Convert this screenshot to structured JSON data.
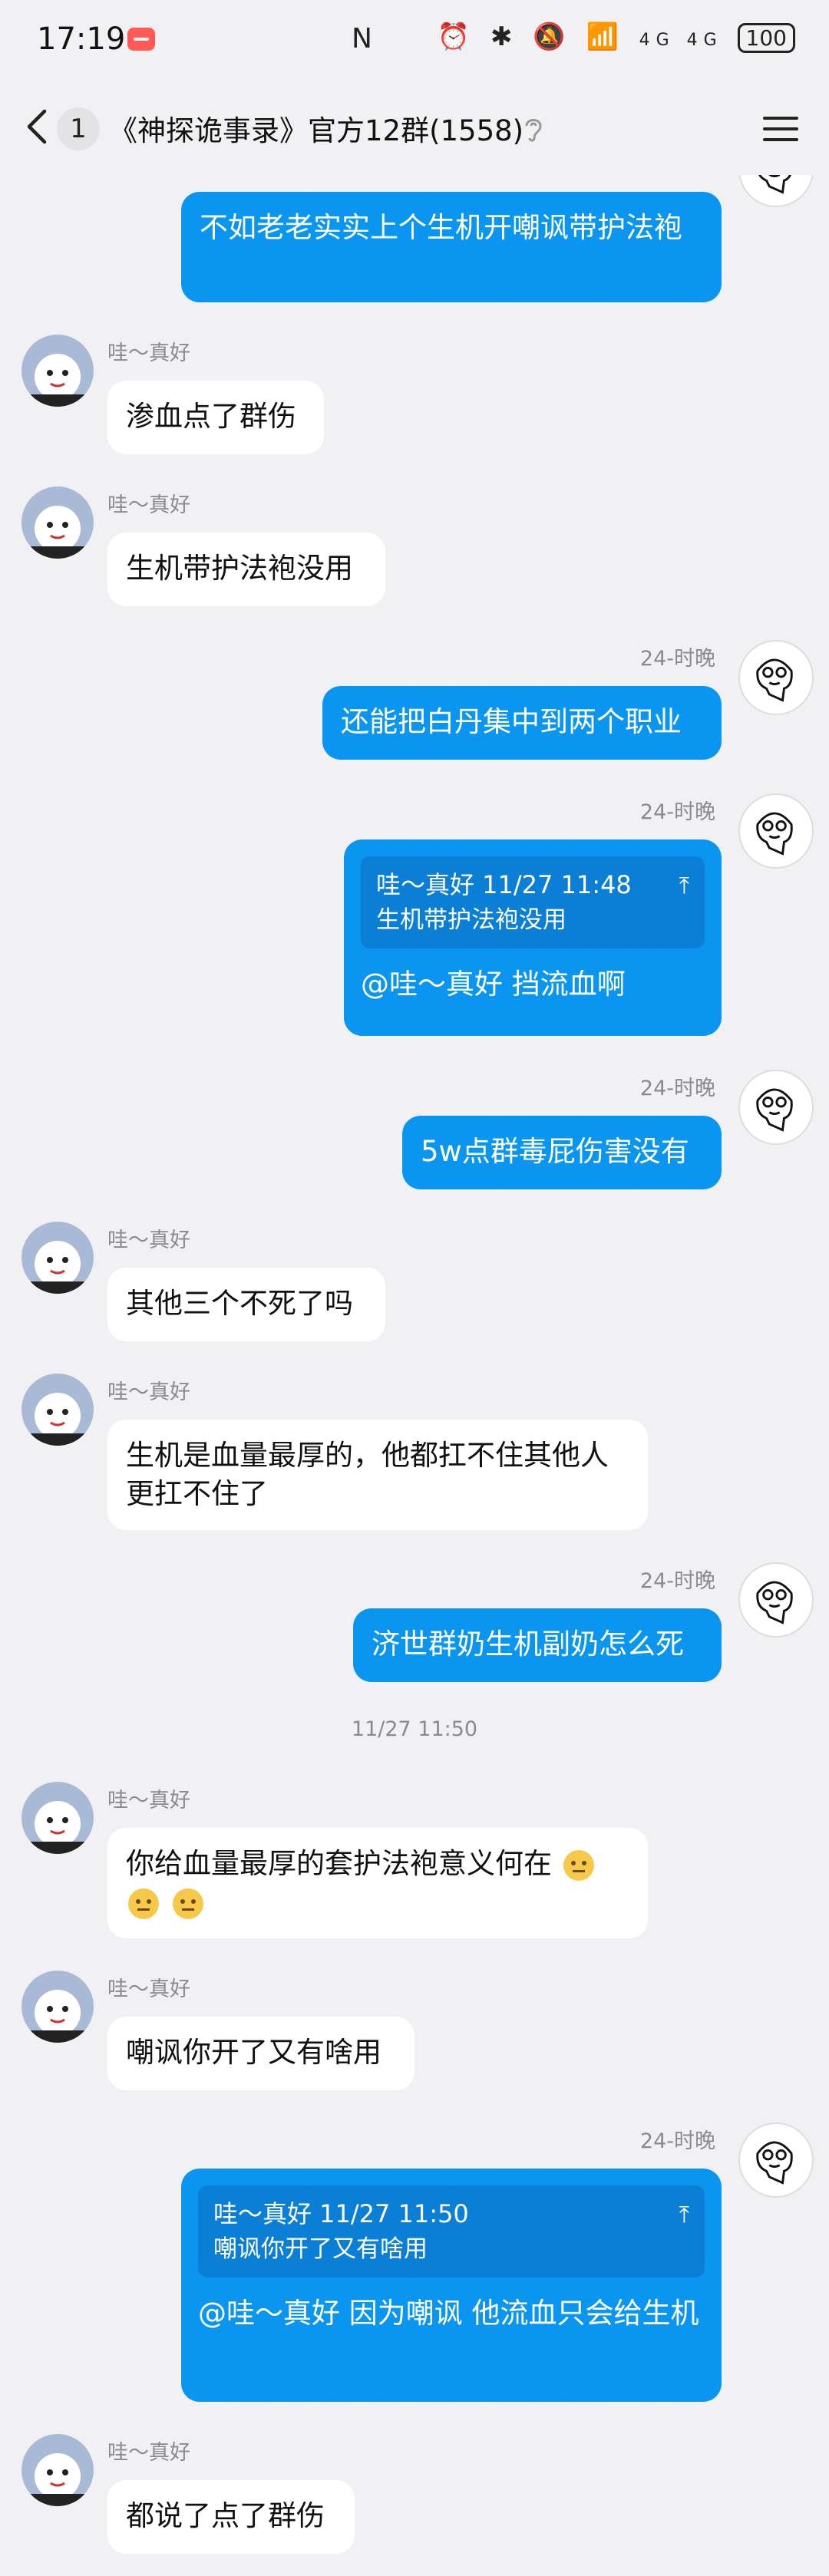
{
  "status_bar": {
    "time": "17:19",
    "nfc": "N",
    "icons": "⏰ ✱ 🔕 📶",
    "network": "4G 4G",
    "battery": "100"
  },
  "header": {
    "unread_count": "1",
    "title": "《神探诡事录》官方12群(1558)"
  },
  "messages": {
    "m0": {
      "text": "不如老老实实上个生机开嘲讽带护法袍"
    },
    "m1": {
      "name": "哇～真好",
      "text": "渗血点了群伤"
    },
    "m2": {
      "name": "哇～真好",
      "text": "生机带护法袍没用"
    },
    "m3": {
      "name": "24-时晚",
      "text": "还能把白丹集中到两个职业"
    },
    "m4": {
      "name": "24-时晚",
      "quote_head": "哇～真好 11/27 11:48",
      "quote_body": "生机带护法袍没用",
      "text": "@哇～真好 挡流血啊"
    },
    "m5": {
      "name": "24-时晚",
      "text": "5w点群毒屁伤害没有"
    },
    "m6": {
      "name": "哇～真好",
      "text": "其他三个不死了吗"
    },
    "m7": {
      "name": "哇～真好",
      "text": "生机是血量最厚的，他都扛不住其他人更扛不住了"
    },
    "m8": {
      "name": "24-时晚",
      "text": "济世群奶生机副奶怎么死"
    },
    "ts1": "11/27 11:50",
    "m9": {
      "name": "哇～真好",
      "text": "你给血量最厚的套护法袍意义何在"
    },
    "m10": {
      "name": "哇～真好",
      "text": "嘲讽你开了又有啥用"
    },
    "m11": {
      "name": "24-时晚",
      "quote_head": "哇～真好 11/27 11:50",
      "quote_body": "嘲讽你开了又有啥用",
      "text": "@哇～真好 因为嘲讽 他流血只会给生机"
    },
    "m12": {
      "name": "哇～真好",
      "text": "都说了点了群伤"
    }
  }
}
